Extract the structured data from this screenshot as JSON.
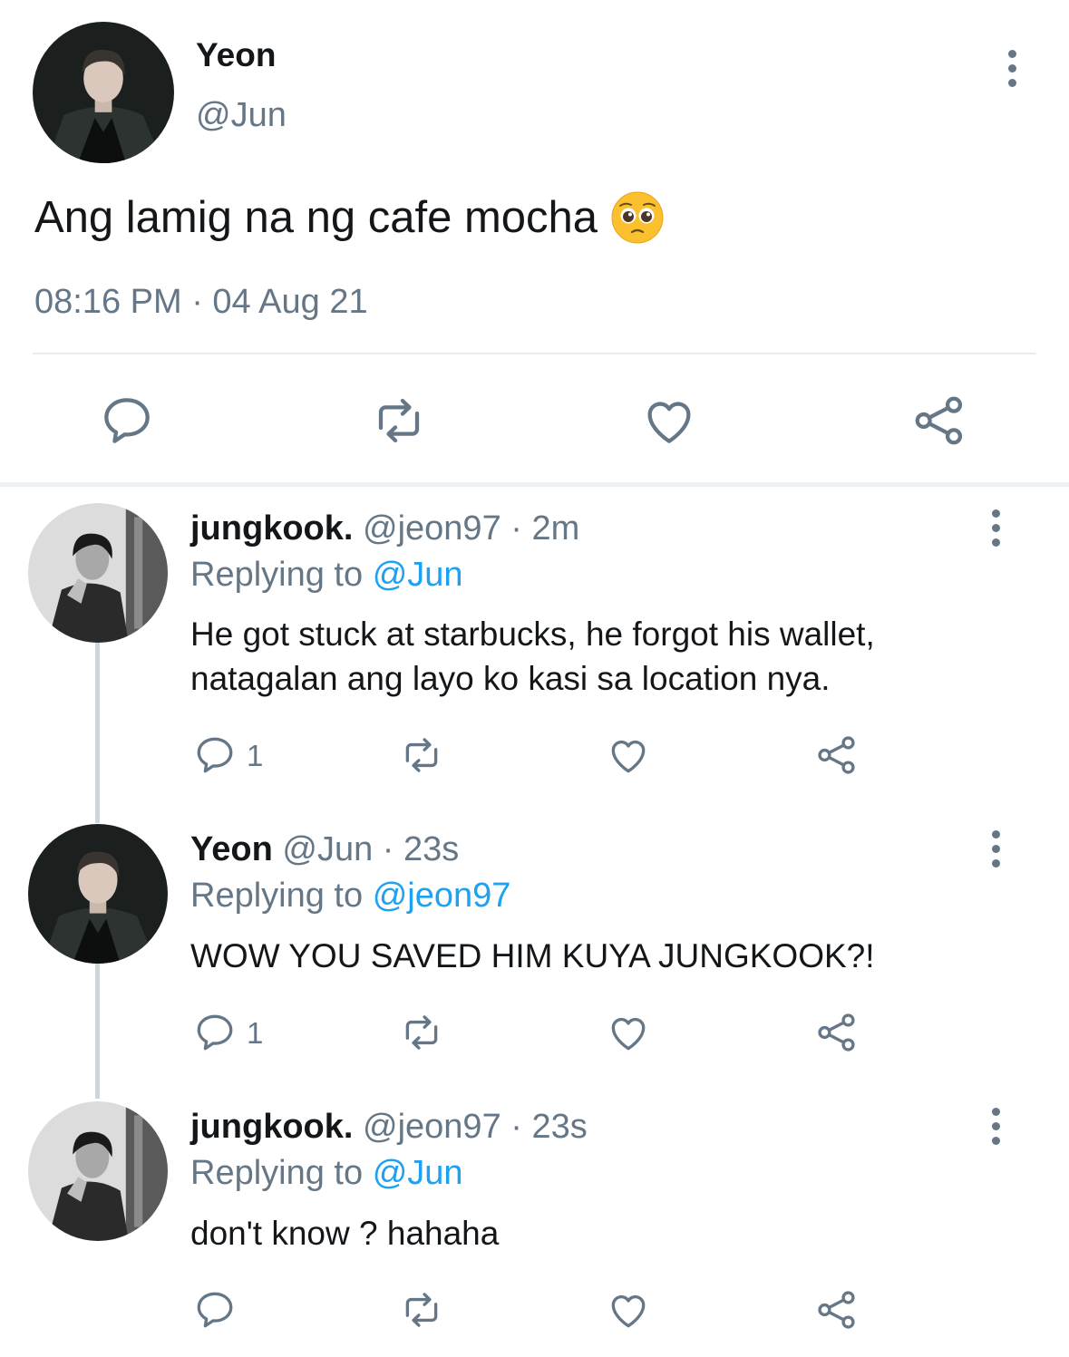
{
  "main_tweet": {
    "display_name": "Yeon",
    "handle": "@Jun",
    "text": "Ang lamig na ng cafe mocha",
    "emoji": "🥺",
    "timestamp": "08:16 PM · 04 Aug 21",
    "actions": [
      "reply-icon",
      "retweet-icon",
      "like-icon",
      "share-icon"
    ]
  },
  "replies": [
    {
      "display_name": "jungkook.",
      "handle": "@jeon97",
      "age": "· 2m",
      "replying_label": "Replying to",
      "replying_to": "@Jun",
      "text": "He got stuck at starbucks, he forgot his wallet, natagalan ang layo ko kasi sa location nya.",
      "reply_count": "1"
    },
    {
      "display_name": "Yeon",
      "handle": "@Jun",
      "age": "· 23s",
      "replying_label": "Replying to",
      "replying_to": "@jeon97",
      "text": "WOW YOU SAVED HIM KUYA JUNGKOOK?!",
      "reply_count": "1"
    },
    {
      "display_name": "jungkook.",
      "handle": "@jeon97",
      "age": "· 23s",
      "replying_label": "Replying to",
      "replying_to": "@Jun",
      "text": "don't know ? hahaha",
      "reply_count": ""
    }
  ],
  "colors": {
    "text": "#14171a",
    "secondary": "#657786",
    "mention": "#1da1f2",
    "divider": "#e6ecf0"
  }
}
